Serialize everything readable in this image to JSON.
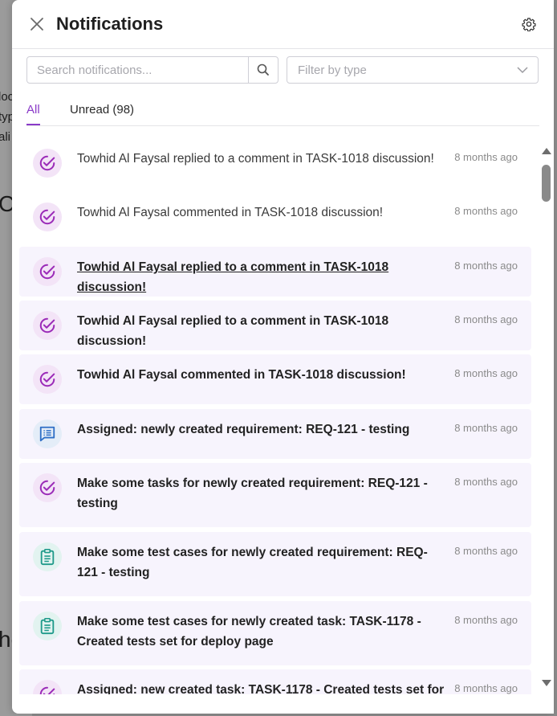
{
  "background": {
    "fragments": [
      "loc",
      "typ",
      "ali",
      "C",
      "he"
    ]
  },
  "panel": {
    "title": "Notifications"
  },
  "search": {
    "placeholder": "Search notifications..."
  },
  "filter": {
    "placeholder": "Filter by type"
  },
  "tabs": [
    {
      "label": "All",
      "active": true
    },
    {
      "label": "Unread (98)",
      "active": false
    }
  ],
  "colors": {
    "accent": "#8a3ac8",
    "task_icon": "#9b2bb8",
    "requirement_icon": "#2f6fc6",
    "testcase_icon": "#1f9a8a",
    "unread_bg": "#f7f4fd"
  },
  "notifications": [
    {
      "icon": "task-check-icon",
      "text": "Towhid Al Faysal replied to a comment in TASK-1018 discussion!",
      "time": "8 months ago",
      "unread": false
    },
    {
      "icon": "task-check-icon",
      "text": "Towhid Al Faysal commented in TASK-1018 discussion!",
      "time": "8 months ago",
      "unread": false
    },
    {
      "icon": "task-check-icon",
      "text": "Towhid Al Faysal replied to a comment in TASK-1018 discussion!",
      "time": "8 months ago",
      "unread": true,
      "hovered": true
    },
    {
      "icon": "task-check-icon",
      "text": "Towhid Al Faysal replied to a comment in TASK-1018 discussion!",
      "time": "8 months ago",
      "unread": true
    },
    {
      "icon": "task-check-icon",
      "text": "Towhid Al Faysal commented in TASK-1018 discussion!",
      "time": "8 months ago",
      "unread": true
    },
    {
      "icon": "requirement-icon",
      "text": "Assigned: newly created requirement: REQ-121 - testing",
      "time": "8 months ago",
      "unread": true
    },
    {
      "icon": "task-check-icon",
      "text": "Make some tasks for newly created requirement: REQ-121 - testing",
      "time": "8 months ago",
      "unread": true
    },
    {
      "icon": "test-case-icon",
      "text": "Make some test cases for newly created requirement: REQ-121 - testing",
      "time": "8 months ago",
      "unread": true
    },
    {
      "icon": "test-case-icon",
      "text": "Make some test cases for newly created task: TASK-1178 - Created tests set for deploy page",
      "time": "8 months ago",
      "unread": true
    },
    {
      "icon": "task-check-icon",
      "text": "Assigned: new created task: TASK-1178 - Created tests set for",
      "time": "8 months ago",
      "unread": true
    }
  ]
}
